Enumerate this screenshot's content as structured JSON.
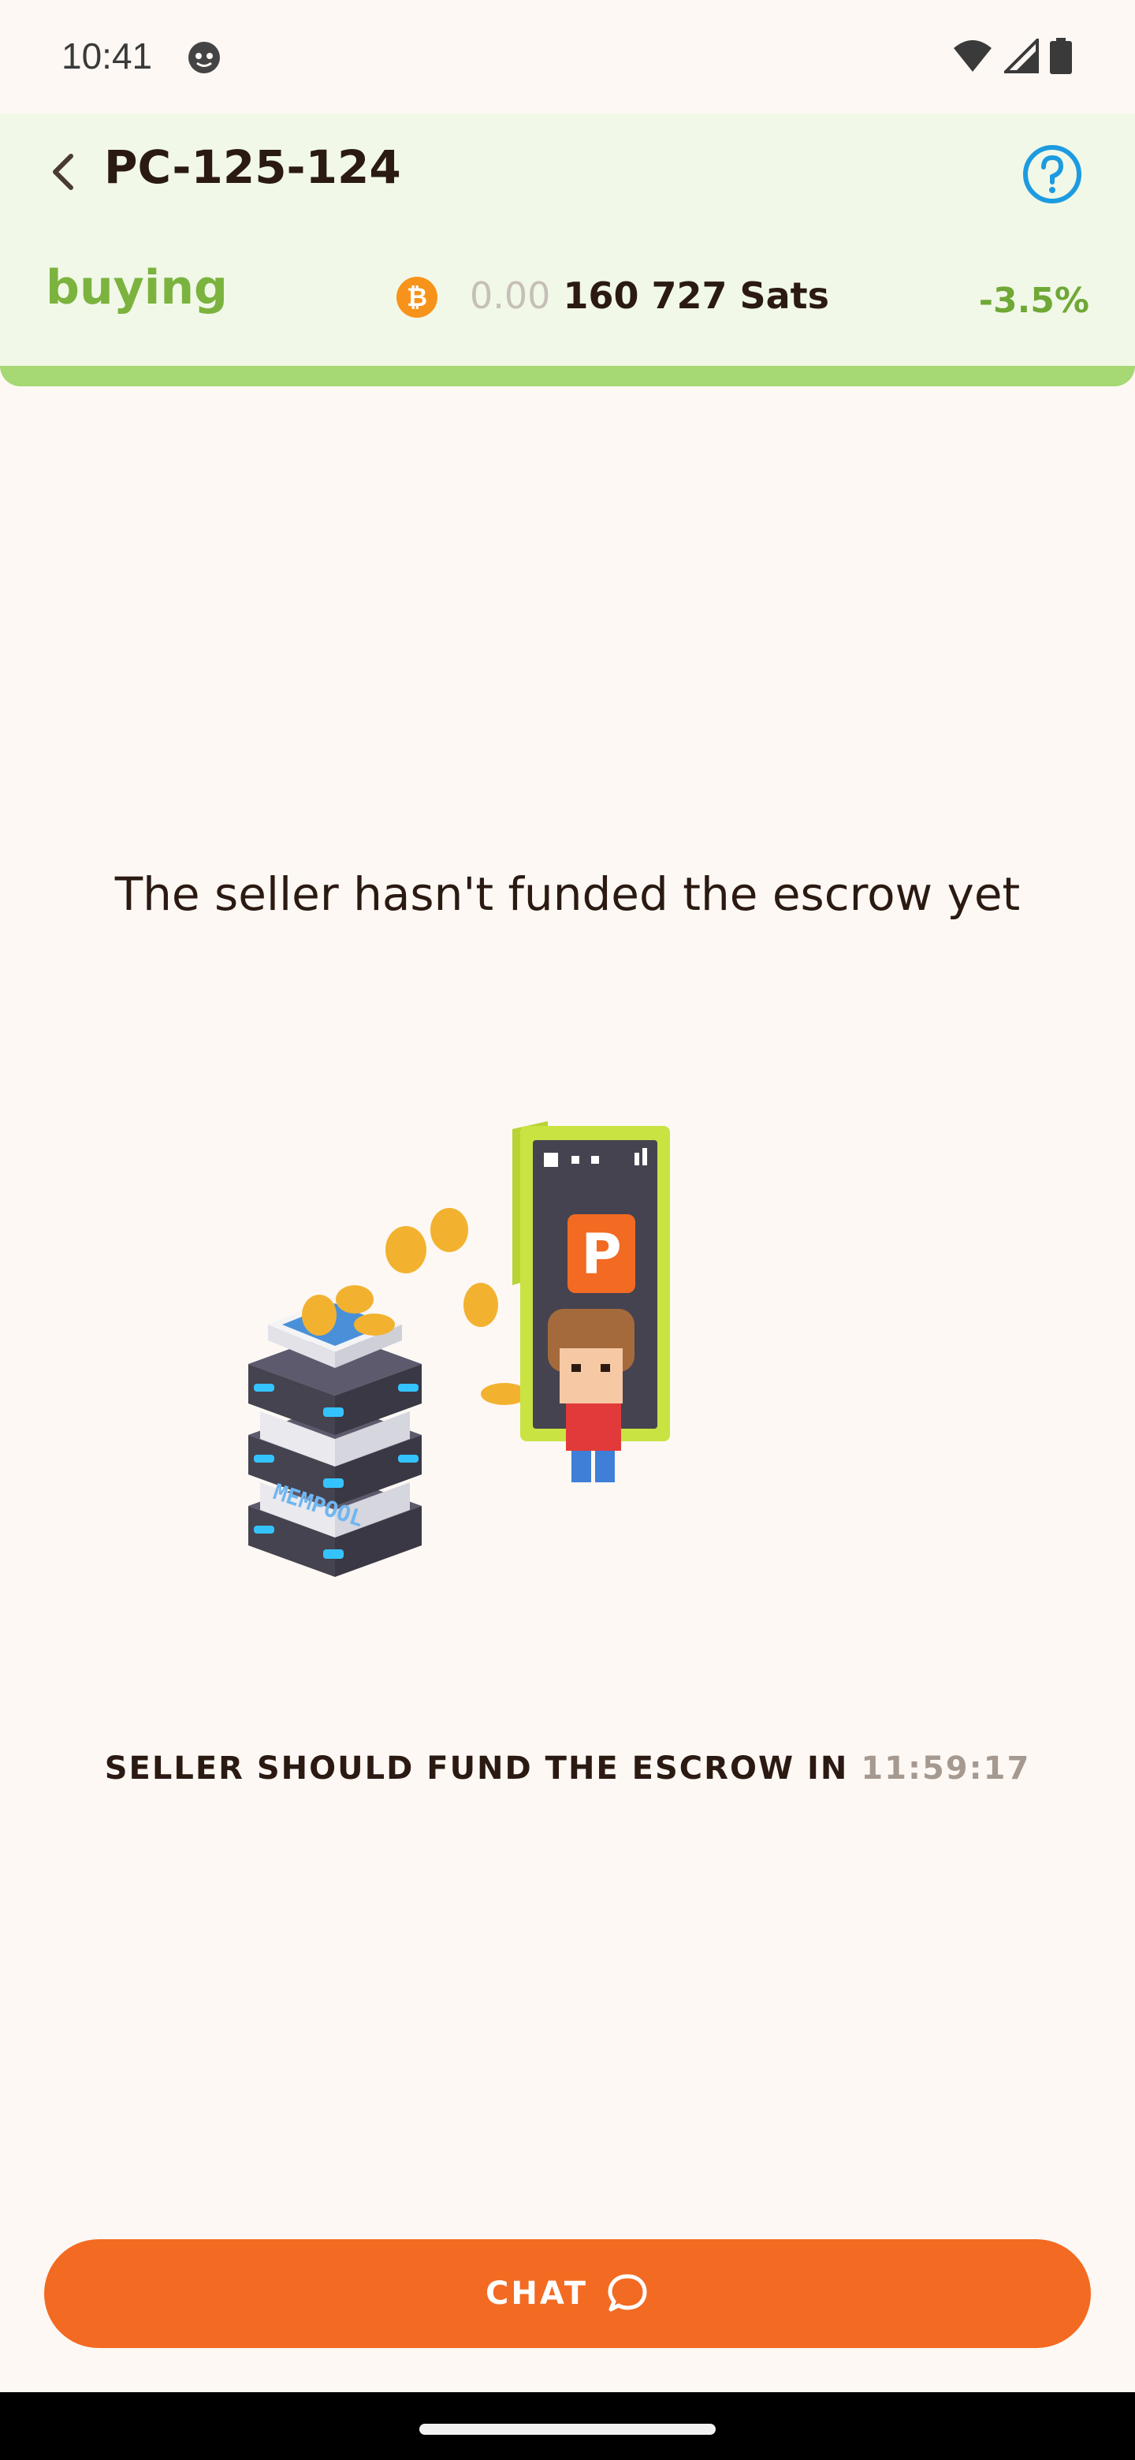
{
  "status_bar": {
    "time": "10:41"
  },
  "header": {
    "trade_id": "PC-125-124",
    "direction": "buying",
    "amount_prefix": "0.00",
    "amount_main": "160 727 Sats",
    "change": "-3.5%"
  },
  "main": {
    "message": "The seller hasn't funded the escrow yet",
    "countdown_label": "SELLER SHOULD FUND THE ESCROW IN",
    "countdown_time": "11:59:17",
    "illustration_text": "MEMPOOL"
  },
  "footer": {
    "chat_label": "CHAT"
  },
  "colors": {
    "background": "#fdf8f4",
    "header_bg": "#f1f8e8",
    "accent_green": "#7bb33e",
    "primary_orange": "#f36a22",
    "help_blue": "#1d9be0",
    "bitcoin_orange": "#f7931a"
  },
  "icons": {
    "back": "chevron-left-icon",
    "help": "question-circle-icon",
    "bitcoin": "bitcoin-icon",
    "chat": "chat-bubble-icon",
    "wifi": "wifi-icon",
    "signal": "cell-signal-icon",
    "battery": "battery-icon"
  }
}
